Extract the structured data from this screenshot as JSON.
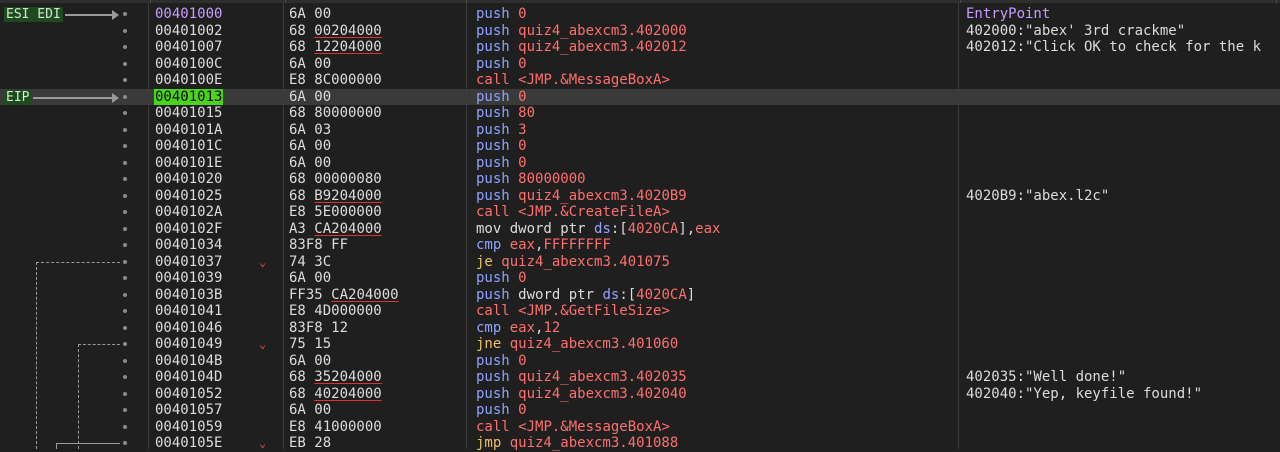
{
  "labels": [
    {
      "text": "ESI EDI",
      "row": 0
    },
    {
      "text": "EIP",
      "row": 5
    }
  ],
  "current_row": 5,
  "rows": [
    {
      "addr": "00401000",
      "bytes": [
        {
          "t": "6A 00"
        }
      ],
      "ins": [
        {
          "t": "push ",
          "c": "t-mn-push"
        },
        {
          "t": "0",
          "c": "t-num"
        }
      ],
      "comment": "EntryPoint",
      "comment_cls": "t-entry",
      "addr_cls": "t-hl-addr"
    },
    {
      "addr": "00401002",
      "bytes": [
        {
          "t": "68 "
        },
        {
          "t": "00204000",
          "u": true
        }
      ],
      "ins": [
        {
          "t": "push ",
          "c": "t-mn-push"
        },
        {
          "t": "quiz4_abexcm3.402000",
          "c": "t-sym"
        }
      ],
      "comment": "402000:\"abex' 3rd crackme\""
    },
    {
      "addr": "00401007",
      "bytes": [
        {
          "t": "68 "
        },
        {
          "t": "12204000",
          "u": true
        }
      ],
      "ins": [
        {
          "t": "push ",
          "c": "t-mn-push"
        },
        {
          "t": "quiz4_abexcm3.402012",
          "c": "t-sym"
        }
      ],
      "comment": "402012:\"Click OK to check for the k"
    },
    {
      "addr": "0040100C",
      "bytes": [
        {
          "t": "6A 00"
        }
      ],
      "ins": [
        {
          "t": "push ",
          "c": "t-mn-push"
        },
        {
          "t": "0",
          "c": "t-num"
        }
      ],
      "comment": ""
    },
    {
      "addr": "0040100E",
      "bytes": [
        {
          "t": "E8 8C000000"
        }
      ],
      "ins": [
        {
          "t": "call ",
          "c": "t-mn-call"
        },
        {
          "t": "<JMP.&MessageBoxA>",
          "c": "t-sym"
        }
      ],
      "comment": ""
    },
    {
      "addr": "00401013",
      "bytes": [
        {
          "t": "6A 00"
        }
      ],
      "ins": [
        {
          "t": "push ",
          "c": "t-mn-push"
        },
        {
          "t": "0",
          "c": "t-num"
        }
      ],
      "comment": ""
    },
    {
      "addr": "00401015",
      "bytes": [
        {
          "t": "68 80000000"
        }
      ],
      "ins": [
        {
          "t": "push ",
          "c": "t-mn-push"
        },
        {
          "t": "80",
          "c": "t-num"
        }
      ],
      "comment": ""
    },
    {
      "addr": "0040101A",
      "bytes": [
        {
          "t": "6A 03"
        }
      ],
      "ins": [
        {
          "t": "push ",
          "c": "t-mn-push"
        },
        {
          "t": "3",
          "c": "t-num"
        }
      ],
      "comment": ""
    },
    {
      "addr": "0040101C",
      "bytes": [
        {
          "t": "6A 00"
        }
      ],
      "ins": [
        {
          "t": "push ",
          "c": "t-mn-push"
        },
        {
          "t": "0",
          "c": "t-num"
        }
      ],
      "comment": ""
    },
    {
      "addr": "0040101E",
      "bytes": [
        {
          "t": "6A 00"
        }
      ],
      "ins": [
        {
          "t": "push ",
          "c": "t-mn-push"
        },
        {
          "t": "0",
          "c": "t-num"
        }
      ],
      "comment": ""
    },
    {
      "addr": "00401020",
      "bytes": [
        {
          "t": "68 00000080"
        }
      ],
      "ins": [
        {
          "t": "push ",
          "c": "t-mn-push"
        },
        {
          "t": "80000000",
          "c": "t-num"
        }
      ],
      "comment": ""
    },
    {
      "addr": "00401025",
      "bytes": [
        {
          "t": "68 "
        },
        {
          "t": "B9204000",
          "u": true
        }
      ],
      "ins": [
        {
          "t": "push ",
          "c": "t-mn-push"
        },
        {
          "t": "quiz4_abexcm3.4020B9",
          "c": "t-sym"
        }
      ],
      "comment": "4020B9:\"abex.l2c\""
    },
    {
      "addr": "0040102A",
      "bytes": [
        {
          "t": "E8 5E000000"
        }
      ],
      "ins": [
        {
          "t": "call ",
          "c": "t-mn-call"
        },
        {
          "t": "<JMP.&CreateFileA>",
          "c": "t-sym"
        }
      ],
      "comment": ""
    },
    {
      "addr": "0040102F",
      "bytes": [
        {
          "t": "A3 "
        },
        {
          "t": "CA204000",
          "u": true
        }
      ],
      "ins": [
        {
          "t": "mov ",
          "c": "t-mn-mov"
        },
        {
          "t": "dword ptr ",
          "c": "t-ptr"
        },
        {
          "t": "ds",
          "c": "t-seg"
        },
        {
          "t": ":[",
          "c": "t-brk"
        },
        {
          "t": "4020CA",
          "c": "t-sym"
        },
        {
          "t": "],",
          "c": "t-brk"
        },
        {
          "t": "eax",
          "c": "t-reg"
        }
      ],
      "comment": ""
    },
    {
      "addr": "00401034",
      "bytes": [
        {
          "t": "83F8 FF"
        }
      ],
      "ins": [
        {
          "t": "cmp ",
          "c": "t-mn-cmp"
        },
        {
          "t": "eax",
          "c": "t-reg"
        },
        {
          "t": ",",
          "c": "t-comma"
        },
        {
          "t": "FFFFFFFF",
          "c": "t-num"
        }
      ],
      "comment": ""
    },
    {
      "addr": "00401037",
      "bytes": [
        {
          "t": "74 3C"
        }
      ],
      "ins": [
        {
          "t": "je ",
          "c": "t-mn-je"
        },
        {
          "t": "quiz4_abexcm3.401075",
          "c": "t-sym"
        }
      ],
      "comment": "",
      "jump": true
    },
    {
      "addr": "00401039",
      "bytes": [
        {
          "t": "6A 00"
        }
      ],
      "ins": [
        {
          "t": "push ",
          "c": "t-mn-push"
        },
        {
          "t": "0",
          "c": "t-num"
        }
      ],
      "comment": ""
    },
    {
      "addr": "0040103B",
      "bytes": [
        {
          "t": "FF35 "
        },
        {
          "t": "CA204000",
          "u": true
        }
      ],
      "ins": [
        {
          "t": "push ",
          "c": "t-mn-push"
        },
        {
          "t": "dword ptr ",
          "c": "t-ptr"
        },
        {
          "t": "ds",
          "c": "t-seg"
        },
        {
          "t": ":[",
          "c": "t-brk"
        },
        {
          "t": "4020CA",
          "c": "t-sym"
        },
        {
          "t": "]",
          "c": "t-brk"
        }
      ],
      "comment": ""
    },
    {
      "addr": "00401041",
      "bytes": [
        {
          "t": "E8 4D000000"
        }
      ],
      "ins": [
        {
          "t": "call ",
          "c": "t-mn-call"
        },
        {
          "t": "<JMP.&GetFileSize>",
          "c": "t-sym"
        }
      ],
      "comment": ""
    },
    {
      "addr": "00401046",
      "bytes": [
        {
          "t": "83F8 12"
        }
      ],
      "ins": [
        {
          "t": "cmp ",
          "c": "t-mn-cmp"
        },
        {
          "t": "eax",
          "c": "t-reg"
        },
        {
          "t": ",",
          "c": "t-comma"
        },
        {
          "t": "12",
          "c": "t-num"
        }
      ],
      "comment": ""
    },
    {
      "addr": "00401049",
      "bytes": [
        {
          "t": "75 15"
        }
      ],
      "ins": [
        {
          "t": "jne ",
          "c": "t-mn-je"
        },
        {
          "t": "quiz4_abexcm3.401060",
          "c": "t-sym"
        }
      ],
      "comment": "",
      "jump": true
    },
    {
      "addr": "0040104B",
      "bytes": [
        {
          "t": "6A 00"
        }
      ],
      "ins": [
        {
          "t": "push ",
          "c": "t-mn-push"
        },
        {
          "t": "0",
          "c": "t-num"
        }
      ],
      "comment": ""
    },
    {
      "addr": "0040104D",
      "bytes": [
        {
          "t": "68 "
        },
        {
          "t": "35204000",
          "u": true
        }
      ],
      "ins": [
        {
          "t": "push ",
          "c": "t-mn-push"
        },
        {
          "t": "quiz4_abexcm3.402035",
          "c": "t-sym"
        }
      ],
      "comment": "402035:\"Well done!\""
    },
    {
      "addr": "00401052",
      "bytes": [
        {
          "t": "68 "
        },
        {
          "t": "40204000",
          "u": true
        }
      ],
      "ins": [
        {
          "t": "push ",
          "c": "t-mn-push"
        },
        {
          "t": "quiz4_abexcm3.402040",
          "c": "t-sym"
        }
      ],
      "comment": "402040:\"Yep, keyfile found!\""
    },
    {
      "addr": "00401057",
      "bytes": [
        {
          "t": "6A 00"
        }
      ],
      "ins": [
        {
          "t": "push ",
          "c": "t-mn-push"
        },
        {
          "t": "0",
          "c": "t-num"
        }
      ],
      "comment": ""
    },
    {
      "addr": "00401059",
      "bytes": [
        {
          "t": "E8 41000000"
        }
      ],
      "ins": [
        {
          "t": "call ",
          "c": "t-mn-call"
        },
        {
          "t": "<JMP.&MessageBoxA>",
          "c": "t-sym"
        }
      ],
      "comment": ""
    },
    {
      "addr": "0040105E",
      "bytes": [
        {
          "t": "EB 28"
        }
      ],
      "ins": [
        {
          "t": "jmp ",
          "c": "t-mn-jmp"
        },
        {
          "t": "quiz4_abexcm3.401088",
          "c": "t-sym"
        }
      ],
      "comment": "",
      "jump": true
    }
  ]
}
